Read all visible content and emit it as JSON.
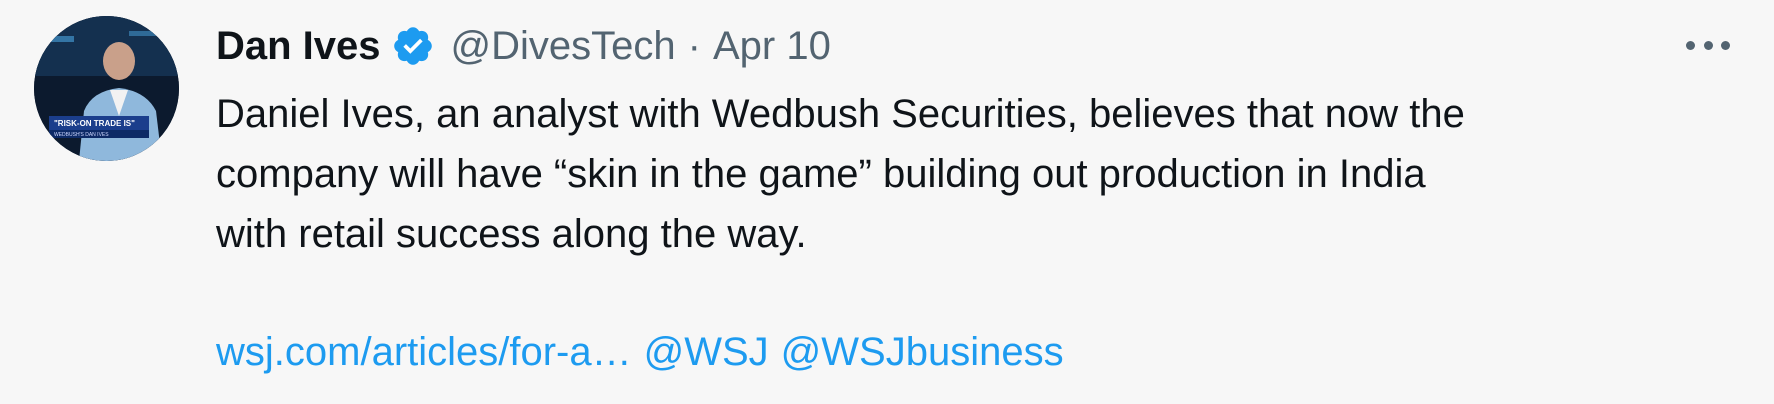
{
  "tweet": {
    "author_name": "Dan Ives",
    "handle": "@DivesTech",
    "separator": "·",
    "date": "Apr 10",
    "verified_icon": "verified-badge-icon",
    "avatar_caption": "\"RISK-ON TRADE IS\"",
    "avatar_subcaption": "WEDBUSH'S DAN IVES",
    "text_lines": [
      "Daniel Ives, an analyst with Wedbush Securities, believes that now the",
      "company will have “skin in the game” building out production in India",
      "with retail success along the way."
    ],
    "links": {
      "url": "wsj.com/articles/for-a…",
      "mention_1": "@WSJ",
      "mention_2": "@WSJbusiness"
    },
    "more_icon": "more-options-icon"
  },
  "colors": {
    "background": "#f7f7f7",
    "text": "#0f1419",
    "secondary": "#536471",
    "link": "#1d9bf0",
    "verified": "#1d9bf0"
  }
}
